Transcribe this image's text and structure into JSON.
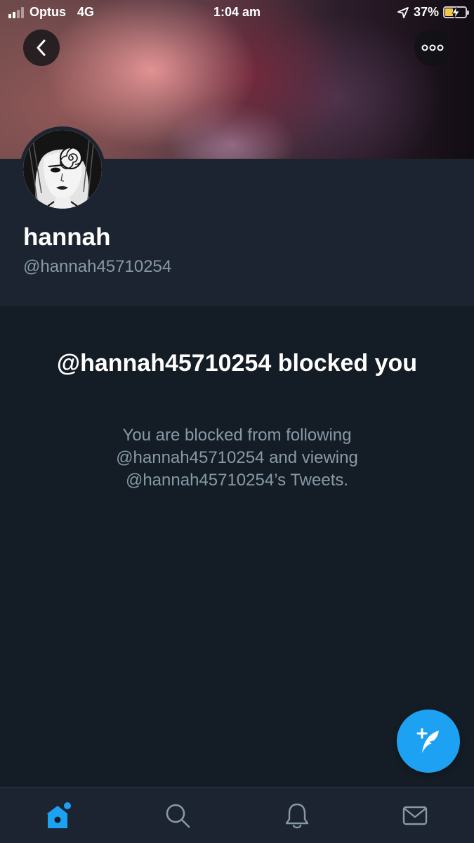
{
  "status_bar": {
    "carrier": "Optus",
    "network": "4G",
    "time": "1:04 am",
    "battery_percent": "37%",
    "battery_level": 0.37,
    "signal_bars_active": 2,
    "signal_bars_total": 4
  },
  "header": {
    "back_icon": "chevron-left-icon",
    "more_icon": "more-dots-icon"
  },
  "profile": {
    "display_name": "hannah",
    "handle": "@hannah45710254"
  },
  "blocked": {
    "title": "@hannah45710254 blocked you",
    "description": "You are blocked from following @hannah45710254 and viewing @hannah45710254’s Tweets."
  },
  "fab": {
    "icon": "compose-tweet-icon"
  },
  "bottom_nav": {
    "items": [
      {
        "name": "home",
        "icon": "home-icon",
        "active": true
      },
      {
        "name": "search",
        "icon": "search-icon",
        "active": false
      },
      {
        "name": "notifications",
        "icon": "bell-icon",
        "active": false
      },
      {
        "name": "messages",
        "icon": "mail-icon",
        "active": false
      }
    ]
  },
  "colors": {
    "accent": "#1da1f2",
    "background": "#141d26",
    "panel": "#1b2430",
    "secondary_text": "#8899a6",
    "battery_charging": "#f2c84b"
  }
}
